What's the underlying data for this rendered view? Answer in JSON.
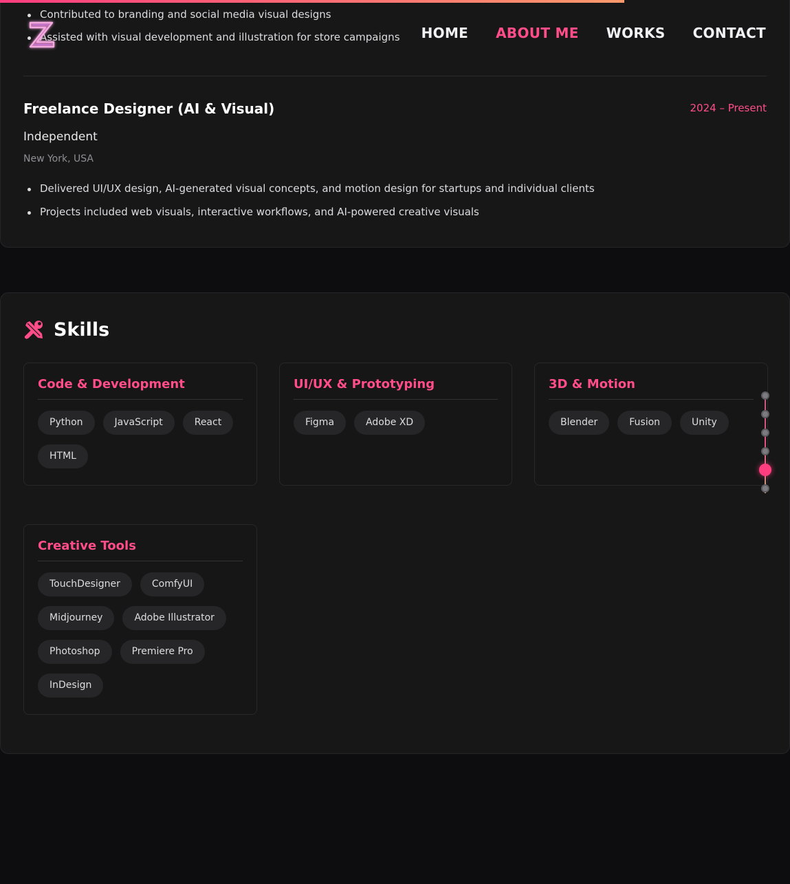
{
  "nav": {
    "items": [
      {
        "label": "HOME",
        "active": false
      },
      {
        "label": "ABOUT ME",
        "active": true
      },
      {
        "label": "WORKS",
        "active": false
      },
      {
        "label": "CONTACT",
        "active": false
      }
    ]
  },
  "previous_bullets": [
    "Contributed to branding and social media visual designs",
    "Assisted with visual development and illustration for store campaigns"
  ],
  "experience": {
    "title": "Freelance Designer (AI & Visual)",
    "date": "2024 – Present",
    "company": "Independent",
    "location": "New York, USA",
    "bullets": [
      "Delivered UI/UX design, AI-generated visual concepts, and motion design for startups and individual clients",
      "Projects included web visuals, interactive workflows, and AI-powered creative visuals"
    ]
  },
  "skills": {
    "title": "Skills",
    "groups": [
      {
        "title": "Code & Development",
        "tags": [
          "Python",
          "JavaScript",
          "React",
          "HTML"
        ]
      },
      {
        "title": "UI/UX & Prototyping",
        "tags": [
          "Figma",
          "Adobe XD"
        ]
      },
      {
        "title": "3D & Motion",
        "tags": [
          "Blender",
          "Fusion",
          "Unity"
        ]
      },
      {
        "title": "Creative Tools",
        "tags": [
          "TouchDesigner",
          "ComfyUI",
          "Midjourney",
          "Adobe Illustrator",
          "Photoshop",
          "Premiere Pro",
          "InDesign"
        ]
      }
    ]
  },
  "section_nav": {
    "count": 6,
    "active_index": 4
  },
  "colors": {
    "accent": "#ff4d8a",
    "background": "#0d0d0f",
    "card": "#171718",
    "tag": "#262628"
  }
}
